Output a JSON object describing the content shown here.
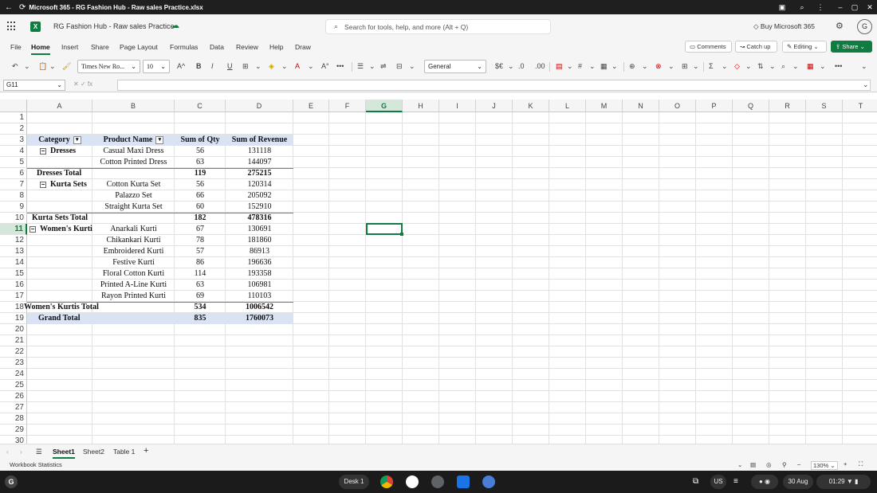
{
  "window": {
    "title": "Microsoft 365 - RG Fashion Hub - Raw sales Practice.xlsx"
  },
  "app": {
    "doc_name": "RG Fashion Hub - Raw sales Practice",
    "search_placeholder": "Search for tools, help, and more (Alt + Q)",
    "buy": "Buy Microsoft 365",
    "avatar": "G"
  },
  "menu": {
    "items": [
      "File",
      "Home",
      "Insert",
      "Share",
      "Page Layout",
      "Formulas",
      "Data",
      "Review",
      "Help",
      "Draw"
    ],
    "active": "Home",
    "comments": "Comments",
    "catchup": "Catch up",
    "editing": "Editing",
    "share": "Share"
  },
  "toolbar": {
    "font_name": "Times New Ro...",
    "font_size": "10",
    "number_format": "General"
  },
  "formula_bar": {
    "name_box": "G11",
    "formula": ""
  },
  "columns": [
    "A",
    "B",
    "C",
    "D",
    "E",
    "F",
    "G",
    "H",
    "I",
    "J",
    "K",
    "L",
    "M",
    "N",
    "O",
    "P",
    "Q",
    "R",
    "S",
    "T"
  ],
  "selected_col": "G",
  "selected_row": 11,
  "rows": [
    1,
    2,
    3,
    4,
    5,
    6,
    7,
    8,
    9,
    10,
    11,
    12,
    13,
    14,
    15,
    16,
    17,
    18,
    19,
    20,
    21,
    22,
    23,
    24,
    25,
    26,
    27,
    28,
    29,
    30
  ],
  "pivot": {
    "headers": {
      "category": "Category",
      "product": "Product Name",
      "qty": "Sum of  Qty",
      "revenue": "Sum of Revenue"
    },
    "r4": {
      "a": "Dresses",
      "b": "Casual Maxi Dress",
      "c": "56",
      "d": "131118"
    },
    "r5": {
      "b": "Cotton Printed Dress",
      "c": "63",
      "d": "144097"
    },
    "r6": {
      "a": "Dresses  Total",
      "c": "119",
      "d": "275215"
    },
    "r7": {
      "a": "Kurta Sets",
      "b": "Cotton Kurta Set",
      "c": "56",
      "d": "120314"
    },
    "r8": {
      "b": "Palazzo Set",
      "c": "66",
      "d": "205092"
    },
    "r9": {
      "b": "Straight Kurta Set",
      "c": "60",
      "d": "152910"
    },
    "r10": {
      "a": "Kurta Sets  Total",
      "c": "182",
      "d": "478316"
    },
    "r11": {
      "a": "Women's Kurtis",
      "b": "Anarkali Kurti",
      "c": "67",
      "d": "130691"
    },
    "r12": {
      "b": "Chikankari Kurti",
      "c": "78",
      "d": "181860"
    },
    "r13": {
      "b": "Embroidered Kurti",
      "c": "57",
      "d": "86913"
    },
    "r14": {
      "b": "Festive Kurti",
      "c": "86",
      "d": "196636"
    },
    "r15": {
      "b": "Floral Cotton Kurti",
      "c": "114",
      "d": "193358"
    },
    "r16": {
      "b": "Printed A-Line Kurti",
      "c": "63",
      "d": "106981"
    },
    "r17": {
      "b": "Rayon Printed Kurti",
      "c": "69",
      "d": "110103"
    },
    "r18": {
      "a": "Women's Kurtis  Total",
      "c": "534",
      "d": "1006542"
    },
    "r19": {
      "a": "Grand Total",
      "c": "835",
      "d": "1760073"
    }
  },
  "sheets": [
    "Sheet1",
    "Sheet2",
    "Table 1"
  ],
  "active_sheet": "Sheet1",
  "status": {
    "left": "Workbook Statistics",
    "zoom": "130%"
  },
  "shelf": {
    "desk": "Desk 1",
    "lang": "US",
    "date": "30 Aug",
    "time": "01:29"
  }
}
